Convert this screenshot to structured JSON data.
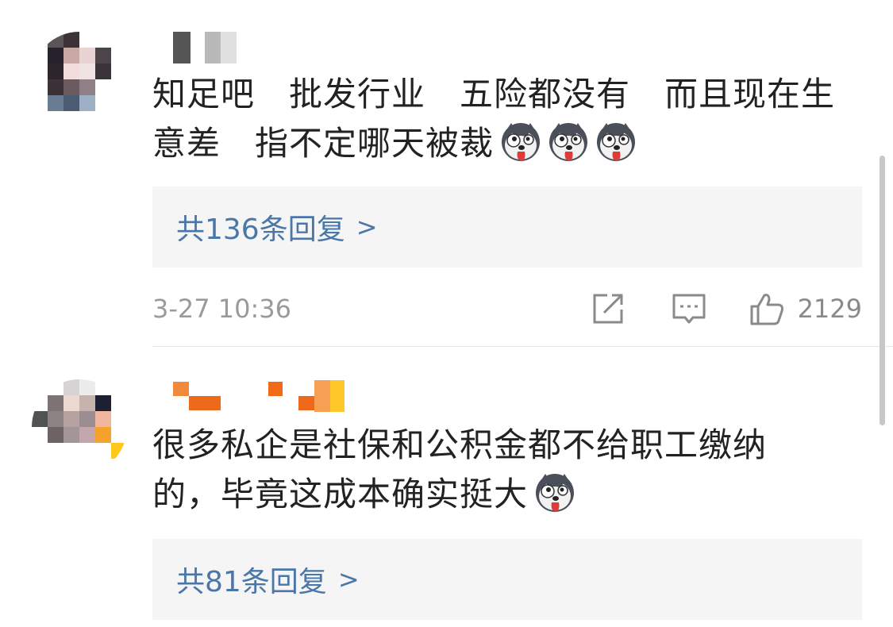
{
  "comments": [
    {
      "text_lines": [
        "知足吧　批发行业　五险都没有　而且现在生",
        "意差　指不定哪天被裁"
      ],
      "emoji_count": 3,
      "emoji_name": "husky-emoji",
      "replies_label": "共136条回复",
      "replies_arrow": ">",
      "time": "3-27 10:36",
      "likes": "2129"
    },
    {
      "text_lines": [
        "很多私企是社保和公积金都不给职工缴纳",
        "的，毕竟这成本确实挺大"
      ],
      "emoji_count": 1,
      "emoji_name": "husky-emoji",
      "replies_label": "共81条回复",
      "replies_arrow": ">"
    }
  ],
  "colors": {
    "link": "#4a76a8",
    "text": "#222222",
    "muted": "#9a9a9a",
    "reply_bg": "#f5f5f5"
  },
  "icons": [
    "share-icon",
    "comment-icon",
    "like-icon"
  ]
}
